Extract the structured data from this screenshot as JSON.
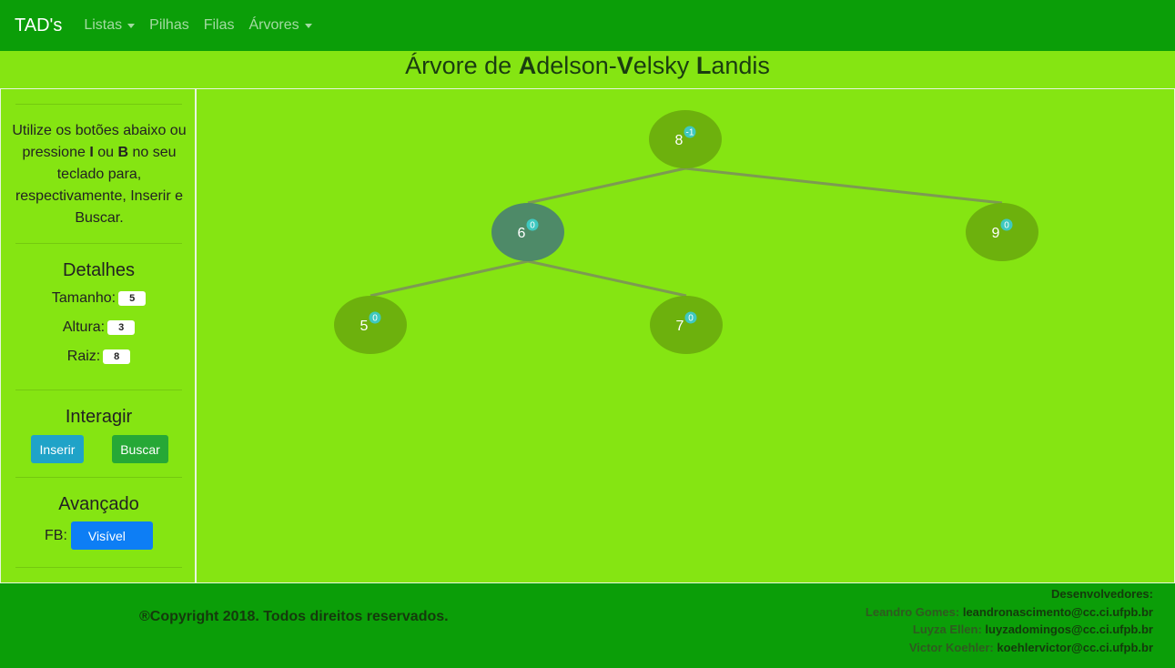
{
  "navbar": {
    "brand": "TAD's",
    "items": [
      {
        "label": "Listas",
        "dropdown": true
      },
      {
        "label": "Pilhas",
        "dropdown": false
      },
      {
        "label": "Filas",
        "dropdown": false
      },
      {
        "label": "Árvores",
        "dropdown": true
      }
    ]
  },
  "title": {
    "prefix": "Árvore de ",
    "a_bold": "A",
    "a_rest": "delson-",
    "v_bold": "V",
    "v_rest": "elsky ",
    "l_bold": "L",
    "l_rest": "andis"
  },
  "sidebar": {
    "instructions": {
      "part1": "Utilize os botões abaixo ou pressione ",
      "key1": "I",
      "part2": " ou ",
      "key2": "B",
      "part3": " no seu teclado para, respectivamente, Inserir e Buscar."
    },
    "details_title": "Detalhes",
    "details": {
      "size_label": "Tamanho:",
      "size_value": "5",
      "height_label": "Altura:",
      "height_value": "3",
      "root_label": "Raiz:",
      "root_value": "8"
    },
    "interact_title": "Interagir",
    "insert_button": "Inserir",
    "search_button": "Buscar",
    "advanced_title": "Avançado",
    "fb_label": "FB:",
    "fb_button": "Visível"
  },
  "tree": {
    "nodes": [
      {
        "key": "8",
        "balance": "-1",
        "depth": 0,
        "slot": 0,
        "highlight": false
      },
      {
        "key": "6",
        "balance": "0",
        "depth": 1,
        "slot": 0,
        "highlight": true
      },
      {
        "key": "9",
        "balance": "0",
        "depth": 1,
        "slot": 1,
        "highlight": false
      },
      {
        "key": "5",
        "balance": "0",
        "depth": 2,
        "slot": 0,
        "highlight": false
      },
      {
        "key": "7",
        "balance": "0",
        "depth": 2,
        "slot": 1,
        "highlight": false
      }
    ],
    "edges": [
      [
        "8",
        "6"
      ],
      [
        "8",
        "9"
      ],
      [
        "6",
        "5"
      ],
      [
        "6",
        "7"
      ]
    ],
    "colors": {
      "node": "#6db10d",
      "node_highlight": "#4e8a68",
      "badge": "#3fc8c0",
      "edge": "#7d9a52"
    }
  },
  "footer": {
    "copyright": "®Copyright 2018. Todos direitos reservados.",
    "devs_title": "Desenvolvedores:",
    "devs": [
      {
        "name": "Leandro Gomes:",
        "email": "leandronascimento@cc.ci.ufpb.br"
      },
      {
        "name": "Luyza Ellen:",
        "email": "luyzadomingos@cc.ci.ufpb.br"
      },
      {
        "name": "Victor Koehler:",
        "email": "koehlervictor@cc.ci.ufpb.br"
      }
    ]
  }
}
